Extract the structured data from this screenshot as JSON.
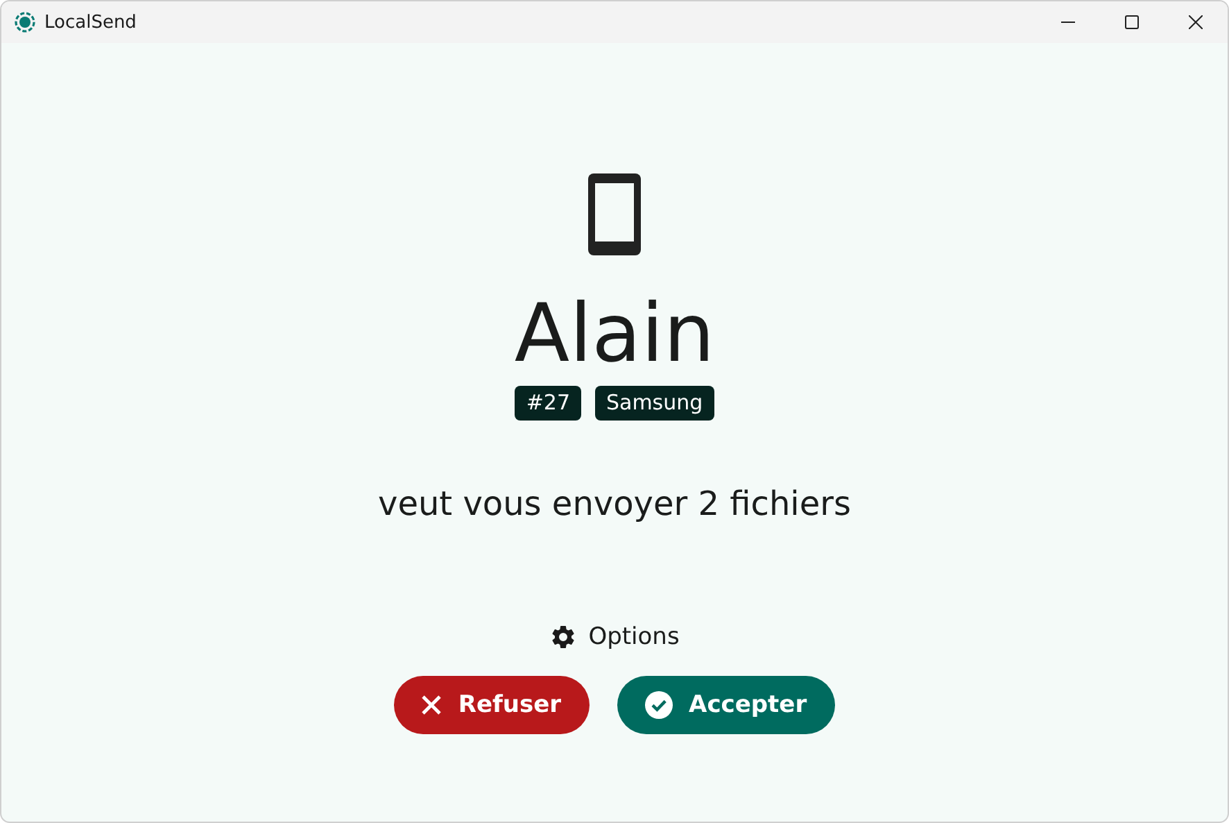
{
  "window": {
    "title": "LocalSend"
  },
  "sender": {
    "name": "Alain",
    "tags": [
      "#27",
      "Samsung"
    ]
  },
  "message": "veut vous envoyer 2 fichiers",
  "options": {
    "label": "Options"
  },
  "buttons": [
    {
      "kind": "decline",
      "label": "Refuser"
    },
    {
      "kind": "accept",
      "label": "Accepter"
    }
  ]
}
